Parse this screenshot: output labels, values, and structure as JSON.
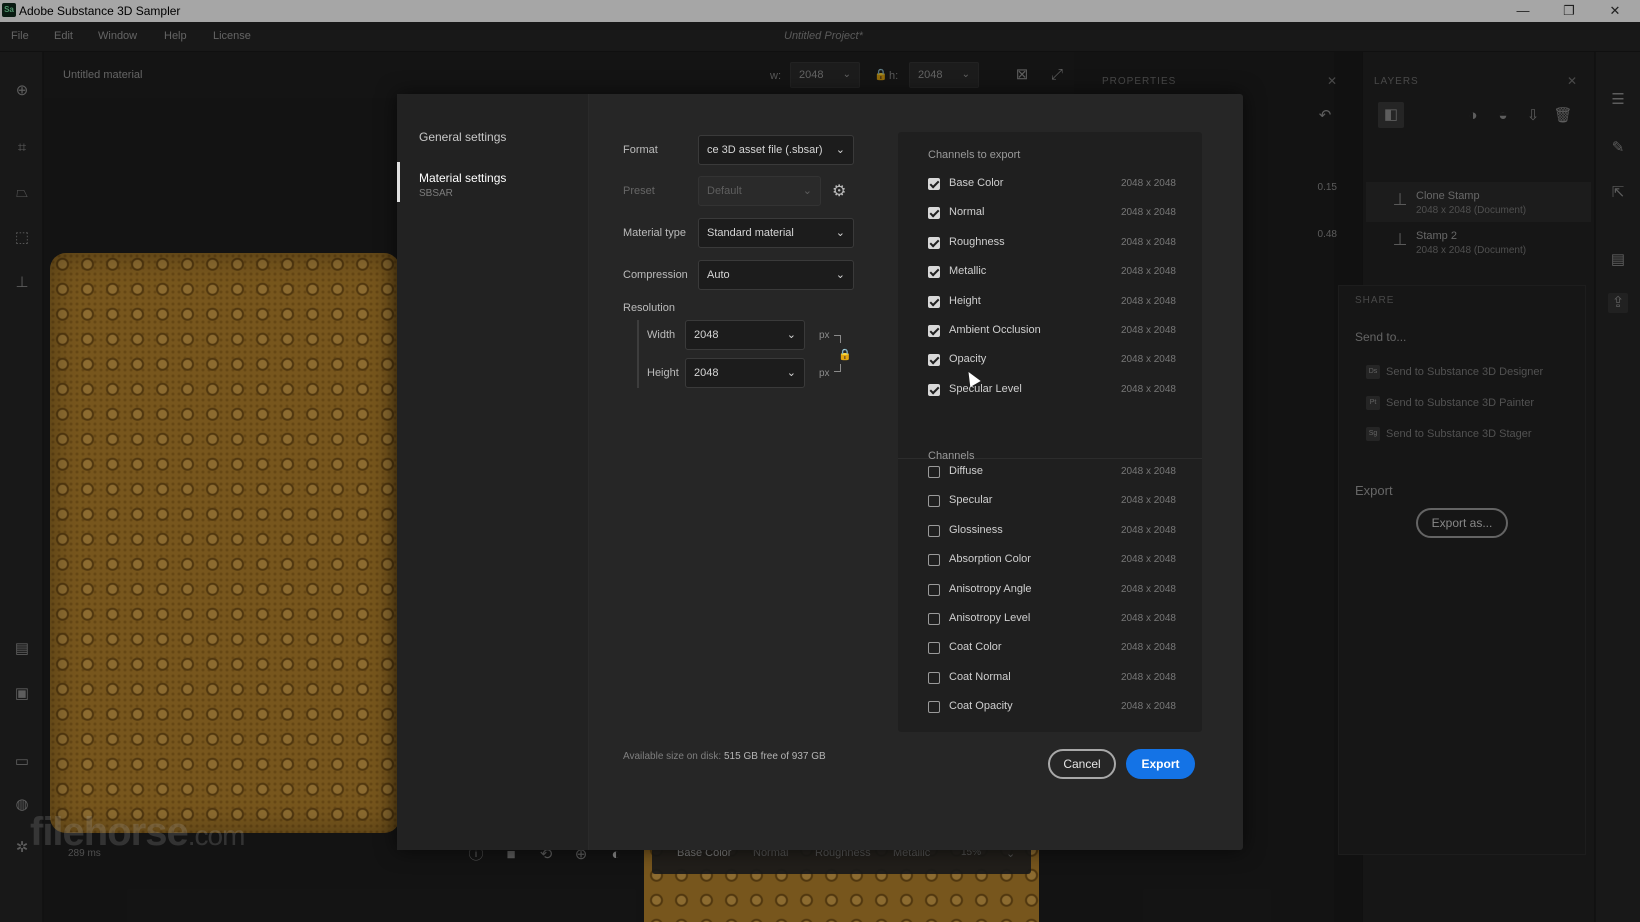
{
  "window": {
    "title": "Adobe Substance 3D Sampler",
    "logo_text": "Sa",
    "minimize": "—",
    "restore": "❐",
    "close": "✕"
  },
  "menu": {
    "items": [
      "File",
      "Edit",
      "Window",
      "Help",
      "License"
    ],
    "project_title": "Untitled Project*"
  },
  "viewport": {
    "material_name": "Untitled material",
    "width_label": "w:",
    "width_value": "2048",
    "height_label": "h:",
    "height_value": "2048",
    "fps": "289 ms",
    "watermark_main": "filehorse",
    "watermark_suffix": ".com",
    "channel_tabs": [
      "Base Color",
      "Normal",
      "Roughness",
      "Metallic"
    ],
    "channel_zoom": "15%"
  },
  "properties": {
    "title": "PROPERTIES",
    "values": [
      "0.15",
      "0.48"
    ]
  },
  "layers": {
    "title": "LAYERS",
    "items": [
      {
        "name": "Clone Stamp",
        "sub": "2048 x 2048 (Document)"
      },
      {
        "name": "Stamp 2",
        "sub": "2048 x 2048 (Document)"
      }
    ]
  },
  "share": {
    "title": "SHARE",
    "send_to": "Send to...",
    "targets": [
      {
        "app": "Ds",
        "label": "Send to Substance 3D Designer"
      },
      {
        "app": "Pt",
        "label": "Send to Substance 3D Painter"
      },
      {
        "app": "Sg",
        "label": "Send to Substance 3D Stager"
      }
    ],
    "export_title": "Export",
    "export_as": "Export as..."
  },
  "dialog": {
    "nav": {
      "general": "General settings",
      "material": "Material settings",
      "material_sub": "SBSAR"
    },
    "format_label": "Format",
    "format_value": "ce 3D asset file (.sbsar)",
    "preset_label": "Preset",
    "preset_value": "Default",
    "material_type_label": "Material type",
    "material_type_value": "Standard material",
    "compression_label": "Compression",
    "compression_value": "Auto",
    "resolution_label": "Resolution",
    "width_label": "Width",
    "width_value": "2048",
    "height_label": "Height",
    "height_value": "2048",
    "px": "px",
    "channels_to_export_title": "Channels to export",
    "channels_to_export": [
      {
        "name": "Base Color",
        "size": "2048 x 2048",
        "checked": true
      },
      {
        "name": "Normal",
        "size": "2048 x 2048",
        "checked": true
      },
      {
        "name": "Roughness",
        "size": "2048 x 2048",
        "checked": true
      },
      {
        "name": "Metallic",
        "size": "2048 x 2048",
        "checked": true
      },
      {
        "name": "Height",
        "size": "2048 x 2048",
        "checked": true
      },
      {
        "name": "Ambient Occlusion",
        "size": "2048 x 2048",
        "checked": true
      },
      {
        "name": "Opacity",
        "size": "2048 x 2048",
        "checked": true
      },
      {
        "name": "Specular Level",
        "size": "2048 x 2048",
        "checked": true
      }
    ],
    "channels_title": "Channels",
    "channels": [
      {
        "name": "Diffuse",
        "size": "2048 x 2048",
        "checked": false
      },
      {
        "name": "Specular",
        "size": "2048 x 2048",
        "checked": false
      },
      {
        "name": "Glossiness",
        "size": "2048 x 2048",
        "checked": false
      },
      {
        "name": "Absorption Color",
        "size": "2048 x 2048",
        "checked": false
      },
      {
        "name": "Anisotropy Angle",
        "size": "2048 x 2048",
        "checked": false
      },
      {
        "name": "Anisotropy Level",
        "size": "2048 x 2048",
        "checked": false
      },
      {
        "name": "Coat Color",
        "size": "2048 x 2048",
        "checked": false
      },
      {
        "name": "Coat Normal",
        "size": "2048 x 2048",
        "checked": false
      },
      {
        "name": "Coat Opacity",
        "size": "2048 x 2048",
        "checked": false
      }
    ],
    "disk_label": "Available size on disk:",
    "disk_value": "515 GB free of 937 GB",
    "cancel": "Cancel",
    "export": "Export"
  },
  "colors": {
    "accent": "#1473e6",
    "material": "#b7852d",
    "background": "#1b1b1b"
  }
}
